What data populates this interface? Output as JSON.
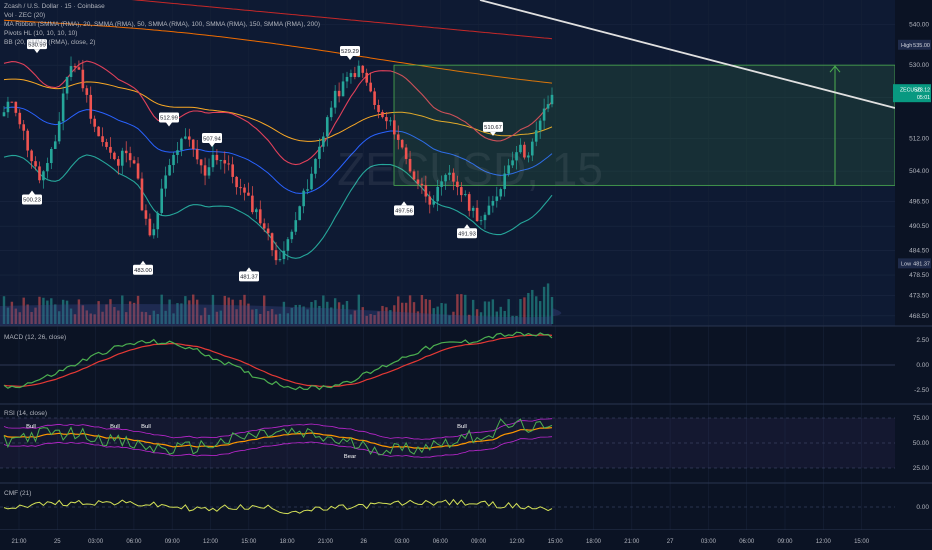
{
  "header": {
    "symbol_line": "Zcash / U.S. Dollar · 15 · Coinbase",
    "indicators": [
      "Vol · ZEC (20)",
      "MA Ribbon (SMMA (RMA), 20, SMMA (RMA), 50, SMMA (RMA), 100, SMMA (RMA), 150, SMMA (RMA), 200)",
      "Pivots HL (10, 10, 10, 10)",
      "BB (20, SMMA (RMA), close, 2)"
    ]
  },
  "watermark": "ZECUSD, 15",
  "price_axis": {
    "ticks": [
      "540.00",
      "530.00",
      "522.00",
      "512.00",
      "504.00",
      "496.50",
      "490.50",
      "484.50",
      "478.50",
      "473.50",
      "468.50"
    ],
    "high": {
      "label": "High",
      "value": "535.00"
    },
    "low": {
      "label": "Low",
      "value": "481.37"
    },
    "current": {
      "symbol": "ZECUSD",
      "price": "523.12",
      "countdown": "05:01"
    }
  },
  "time_axis": {
    "labels": [
      "21:00",
      "25",
      "03:00",
      "06:00",
      "09:00",
      "12:00",
      "15:00",
      "18:00",
      "21:00",
      "26",
      "03:00",
      "06:00",
      "09:00",
      "12:00",
      "15:00",
      "18:00",
      "21:00",
      "27",
      "03:00",
      "06:00",
      "09:00",
      "12:00",
      "15:00"
    ]
  },
  "pivots": [
    {
      "label": "530.99",
      "kind": "high"
    },
    {
      "label": "500.23",
      "kind": "low"
    },
    {
      "label": "483.00",
      "kind": "low"
    },
    {
      "label": "512.99",
      "kind": "high"
    },
    {
      "label": "507.94",
      "kind": "high"
    },
    {
      "label": "481.37",
      "kind": "low"
    },
    {
      "label": "529.29",
      "kind": "high"
    },
    {
      "label": "497.56",
      "kind": "low"
    },
    {
      "label": "491.93",
      "kind": "low"
    },
    {
      "label": "510.67",
      "kind": "high"
    }
  ],
  "panes": {
    "macd": {
      "title": "MACD (12, 26, close)",
      "ticks": [
        "2.50",
        "0.00",
        "-2.50"
      ]
    },
    "rsi": {
      "title": "RSI (14, close)",
      "ticks": [
        "75.00",
        "50.00",
        "25.00"
      ],
      "signals": [
        "Bull",
        "Bull",
        "Bull",
        "Bear",
        "Bull"
      ]
    },
    "cmf": {
      "title": "CMF (21)",
      "ticks": [
        "0.00"
      ]
    }
  },
  "colors": {
    "background": "#0b1324",
    "up": "#26a69a",
    "down": "#ef5350",
    "bb_upper": "#e0405a",
    "bb_lower": "#26a69a",
    "bb_basis": "#2962ff",
    "ma_200": "#c62828",
    "ma_150": "#ef6c00",
    "ma_100": "#f9a825",
    "target_box": "#4caf50",
    "trendline": "#e0e0e0",
    "macd_line": "#4caf50",
    "signal_line": "#e53935",
    "rsi_line": "#4caf50",
    "rsi_ma": "#ff9800",
    "rsi_band": "#c026d3",
    "cmf_line": "#d4e157",
    "current_price": "#089981"
  },
  "chart_data": {
    "type": "candlestick",
    "ylim": [
      466,
      545
    ],
    "x_labels": [
      "21:00",
      "25",
      "03:00",
      "06:00",
      "09:00",
      "12:00",
      "15:00",
      "18:00",
      "21:00",
      "26",
      "03:00",
      "06:00",
      "09:00",
      "12:00"
    ],
    "close_path": [
      518,
      522,
      515,
      508,
      502,
      505,
      512,
      526,
      531,
      526,
      518,
      512,
      509,
      505,
      510,
      506,
      494,
      486,
      498,
      505,
      510,
      512,
      508,
      503,
      508,
      507,
      504,
      500,
      497,
      494,
      490,
      484,
      482,
      490,
      496,
      500,
      508,
      516,
      522,
      525,
      528,
      529,
      524,
      518,
      516,
      514,
      508,
      503,
      500,
      497,
      499,
      503,
      501,
      497,
      494,
      492,
      495,
      500,
      506,
      510,
      508,
      512,
      518,
      523
    ],
    "pivot_values": [
      {
        "label": "530.99",
        "value": 530.99
      },
      {
        "label": "500.23",
        "value": 500.23
      },
      {
        "label": "483.00",
        "value": 483.0
      },
      {
        "label": "512.99",
        "value": 512.99
      },
      {
        "label": "507.94",
        "value": 507.94
      },
      {
        "label": "481.37",
        "value": 481.37
      },
      {
        "label": "529.29",
        "value": 529.29
      },
      {
        "label": "497.56",
        "value": 497.56
      },
      {
        "label": "491.93",
        "value": 491.93
      },
      {
        "label": "510.67",
        "value": 510.67
      }
    ],
    "target_box": {
      "entry": 500.5,
      "target": 530.0
    },
    "macd_range": [
      -3.5,
      3.5
    ],
    "rsi_range": [
      15,
      85
    ],
    "cmf_range": [
      -0.3,
      0.3
    ]
  }
}
